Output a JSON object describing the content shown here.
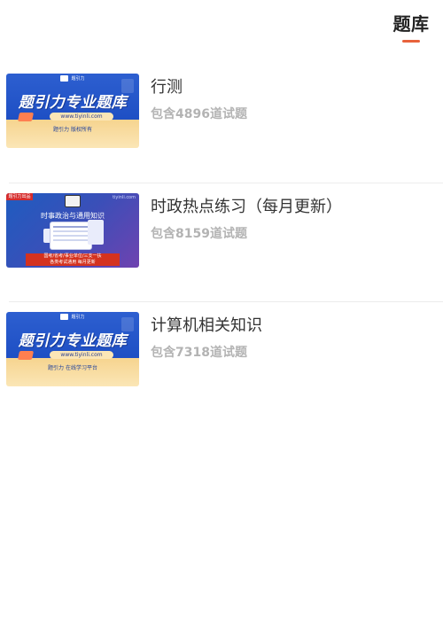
{
  "header": {
    "active_tab": "题库"
  },
  "items": [
    {
      "title": "行测",
      "subtitle": "包含4896道试题",
      "thumb": {
        "style": "blue",
        "logo_text": "题引力",
        "main_text": "题引力专业题库",
        "url": "www.tiyinli.com",
        "bottom_text": "题引力 版权所有"
      }
    },
    {
      "title": "时政热点练习（每月更新）",
      "subtitle": "包含8159道试题",
      "thumb": {
        "style": "purple",
        "badge": "题引力出品",
        "site": "tiyinli.com",
        "headline": "时事政治与通用知识",
        "redbar_line1": "国考/省考/事业单位/三支一扶",
        "redbar_line2": "各类考试通用 每月更新"
      }
    },
    {
      "title": "计算机相关知识",
      "subtitle": "包含7318道试题",
      "thumb": {
        "style": "blue",
        "logo_text": "题引力",
        "main_text": "题引力专业题库",
        "url": "www.tiyinli.com",
        "bottom_text": "题引力 在线学习平台"
      }
    }
  ],
  "colors": {
    "accent": "#e8623b",
    "title": "#333333",
    "subtitle": "#b3b3b3",
    "banner_blue": "#1e4fc4",
    "banner_gold": "#fbe6b6"
  }
}
